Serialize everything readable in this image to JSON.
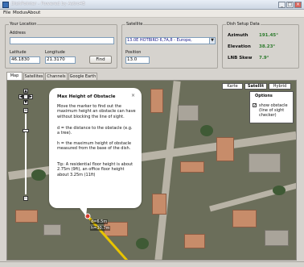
{
  "window": {
    "title": "DishPointer - Powered by Astro4B"
  },
  "menu": [
    "File",
    "Modus",
    "About"
  ],
  "location": {
    "group": "Your Location",
    "address_label": "Address",
    "address_value": "",
    "lat_label": "Latitude",
    "lat_value": "46.1830",
    "lon_label": "Longitude",
    "lon_value": "21.3170",
    "find": "Find"
  },
  "satellite": {
    "group": "Satellite",
    "selected": "13.0E HOTBIRD 6,7A,8 - Europe,",
    "position_label": "Position",
    "position_value": "13.0"
  },
  "dish": {
    "group": "Dish Setup Data",
    "azimuth_label": "Azimuth",
    "azimuth": "191.45°",
    "elevation_label": "Elevation",
    "elevation": "38.23°",
    "skew_label": "LNB Skew",
    "skew": "7.9°"
  },
  "tabs": [
    "Map",
    "Satellites",
    "Channels",
    "Google Earth"
  ],
  "map": {
    "types": [
      "Karte",
      "Satellit",
      "Hybrid"
    ],
    "options_title": "Options",
    "show_obstacle": "show obstacle (line of sight checker)",
    "marker_label_1": "d=6.5m",
    "marker_label_2": "h=30.7m"
  },
  "popup": {
    "title": "Max Height of Obstacle",
    "p1": "Move the marker to find out the maximum height an obstacle can have without blocking the line of sight.",
    "p2": "d = the distance to the obstacle (e.g. a tree).",
    "p3": "h = the maximum height of obstacle measured from the base of the dish.",
    "p4": "Tip: A residential floor height is about 2.75m (9ft), an office floor height about 3.25m (11ft)"
  }
}
